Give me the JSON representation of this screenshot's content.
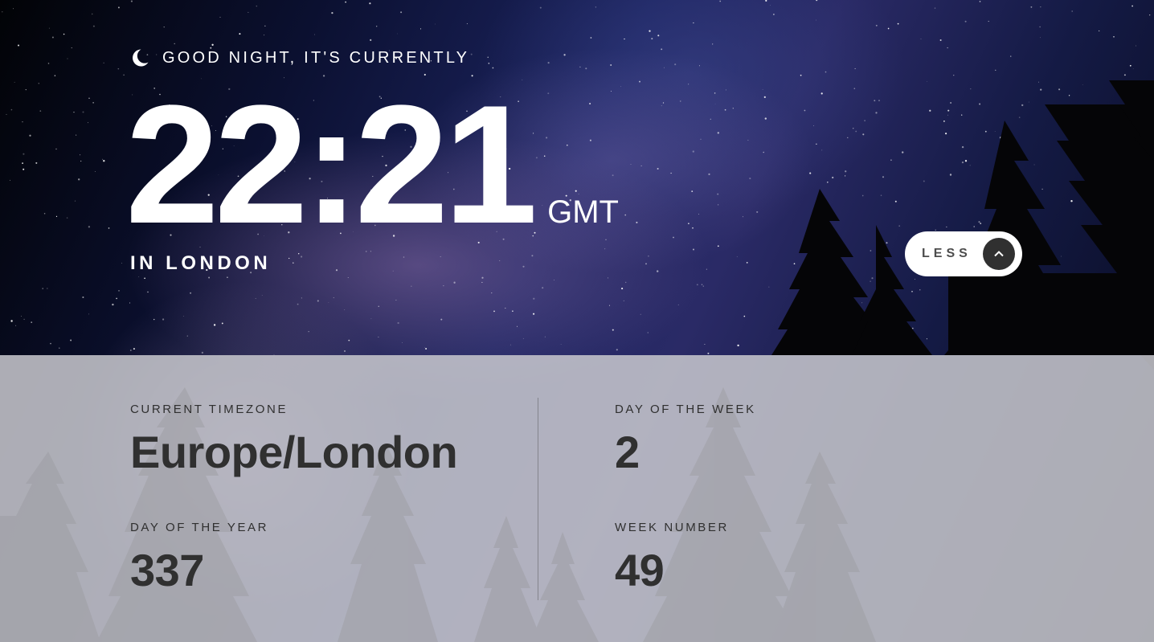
{
  "greeting": {
    "icon": "moon-icon",
    "text": "GOOD NIGHT, IT'S CURRENTLY"
  },
  "clock": {
    "time": "22:21",
    "abbreviation": "GMT",
    "location": "IN LONDON"
  },
  "toggle": {
    "label": "LESS",
    "icon": "chevron-up-icon"
  },
  "details": {
    "timezone": {
      "label": "CURRENT TIMEZONE",
      "value": "Europe/London"
    },
    "day_of_year": {
      "label": "DAY OF THE YEAR",
      "value": "337"
    },
    "day_of_week": {
      "label": "DAY OF THE WEEK",
      "value": "2"
    },
    "week_number": {
      "label": "WEEK NUMBER",
      "value": "49"
    }
  },
  "colors": {
    "text_light": "#ffffff",
    "text_dark": "#303030",
    "button_bg": "#ffffff",
    "chevron_bg": "#303030"
  }
}
